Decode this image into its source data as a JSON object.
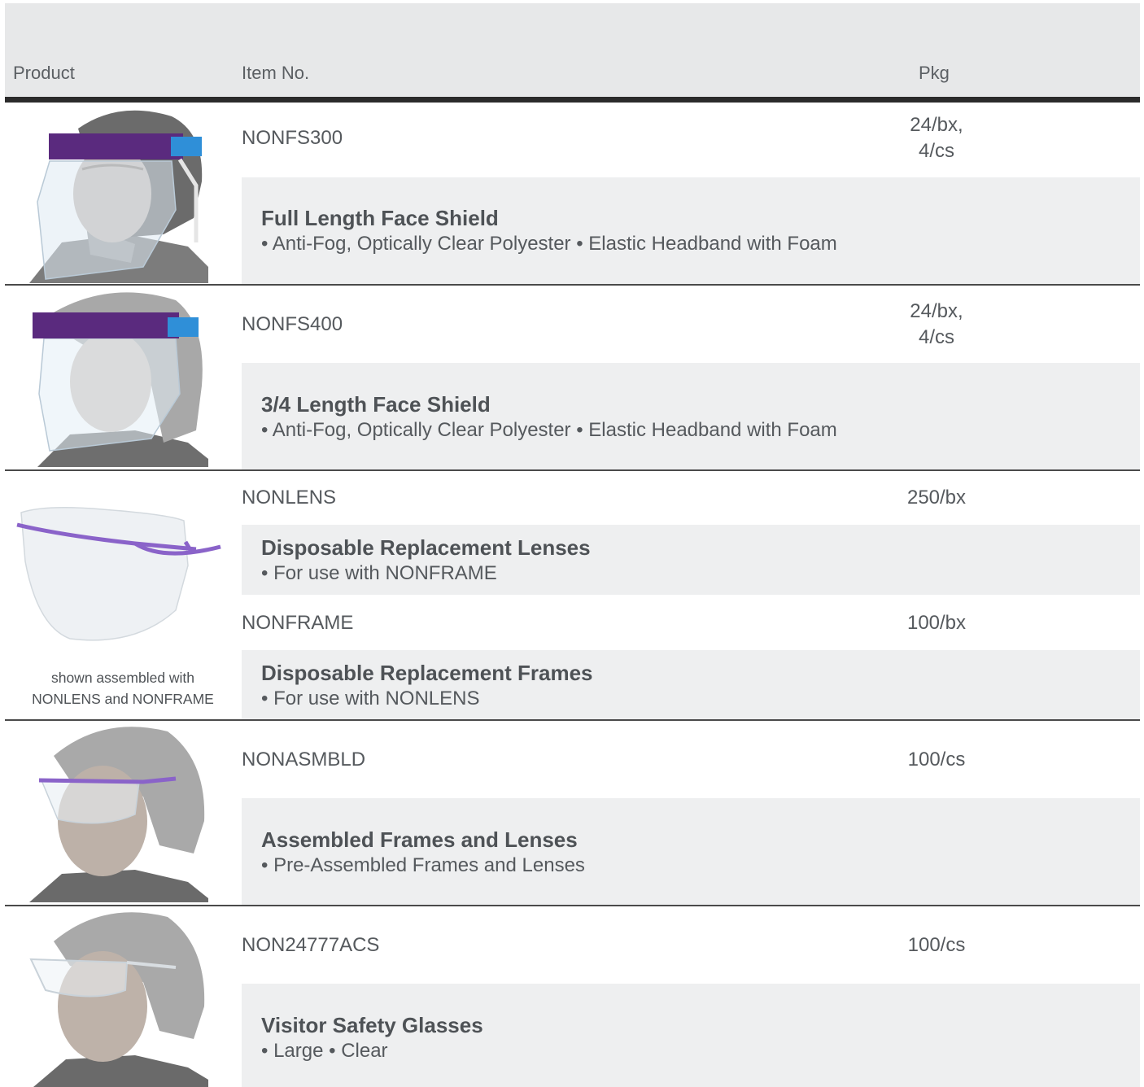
{
  "table": {
    "headers": {
      "product": "Product",
      "item_no": "Item No.",
      "pkg": "Pkg"
    }
  },
  "rows": [
    {
      "item": "NONFS300",
      "pkg": [
        "24/bx,",
        "4/cs"
      ],
      "name": "Full Length Face Shield",
      "desc": "• Anti-Fog, Optically Clear Polyester • Elastic Headband with Foam",
      "image": "full-length-face-shield-photo"
    },
    {
      "item": "NONFS400",
      "pkg": [
        "24/bx,",
        "4/cs"
      ],
      "name": "3/4 Length Face Shield",
      "desc": "• Anti-Fog, Optically Clear Polyester • Elastic Headband with Foam",
      "image": "three-quarter-face-shield-photo"
    },
    {
      "item": "NONLENS",
      "pkg": [
        "250/bx"
      ],
      "name": "Disposable Replacement Lenses",
      "desc": "• For use with NONFRAME",
      "image": "frame-and-lens-photo"
    },
    {
      "item": "NONFRAME",
      "pkg": [
        "100/bx"
      ],
      "name": "Disposable Replacement Frames",
      "desc": "• For use with NONLENS"
    },
    {
      "item": "NONASMBLD",
      "pkg": [
        "100/cs"
      ],
      "name": "Assembled Frames and Lenses",
      "desc": "• Pre-Assembled Frames and Lenses",
      "image": "assembled-frames-photo"
    },
    {
      "item": "NON24777ACS",
      "pkg": [
        "100/cs"
      ],
      "name": "Visitor Safety Glasses",
      "desc": "• Large • Clear",
      "image": "visitor-glasses-photo"
    }
  ],
  "caption": [
    "shown assembled with",
    "NONLENS and NONFRAME"
  ],
  "colors": {
    "header_bg": "#e7e8e9",
    "band_bg": "#eeeff0",
    "rule": "#2b2b2b",
    "text": "#55595d",
    "shield_band": "#5a2a7e",
    "shield_band_blue": "#2f8fd8",
    "frame_purple": "#8a63c9"
  }
}
